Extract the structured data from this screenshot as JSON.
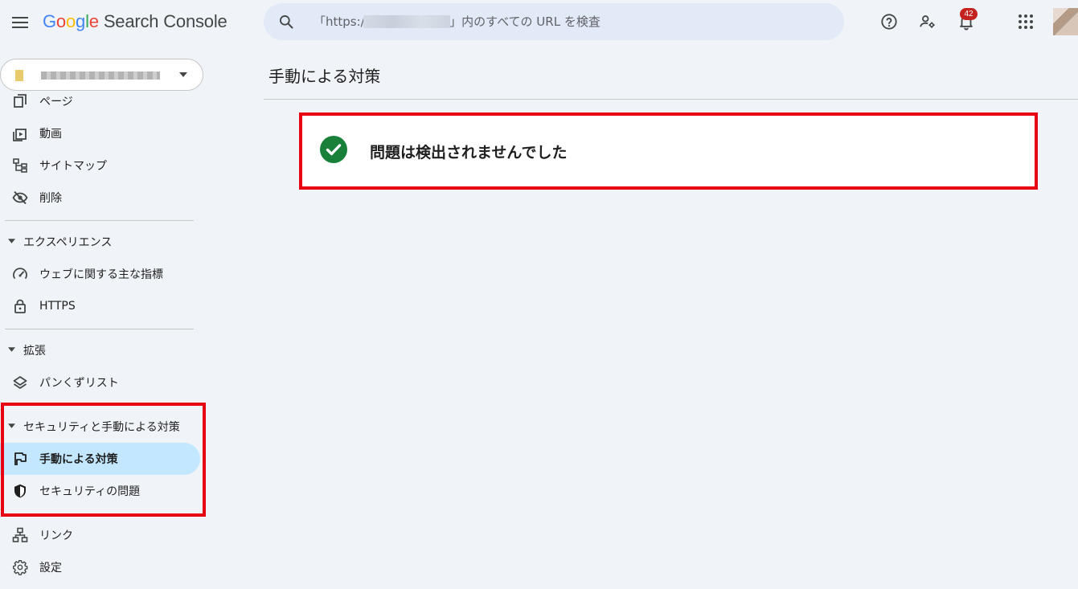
{
  "header": {
    "logo_letters": [
      {
        "ch": "G",
        "color": "#4285F4"
      },
      {
        "ch": "o",
        "color": "#EA4335"
      },
      {
        "ch": "o",
        "color": "#FBBC05"
      },
      {
        "ch": "g",
        "color": "#4285F4"
      },
      {
        "ch": "l",
        "color": "#34A853"
      },
      {
        "ch": "e",
        "color": "#EA4335"
      }
    ],
    "product_name": "Search Console",
    "search_placeholder": "「https://                    /」内のすべての URL を検査",
    "notification_count": "42",
    "icons": [
      "menu-icon",
      "search-icon",
      "help-icon",
      "manage-users-icon",
      "notifications-icon",
      "apps-icon"
    ]
  },
  "sidebar": {
    "items": [
      {
        "label": "ページ",
        "icon": "pages-icon"
      },
      {
        "label": "動画",
        "icon": "video-icon"
      },
      {
        "label": "サイトマップ",
        "icon": "sitemap-icon"
      },
      {
        "label": "削除",
        "icon": "removals-icon"
      }
    ],
    "sections": [
      {
        "title": "エクスペリエンス",
        "items": [
          {
            "label": "ウェブに関する主な指標",
            "icon": "speed-icon"
          },
          {
            "label": "HTTPS",
            "icon": "lock-icon"
          }
        ]
      },
      {
        "title": "拡張",
        "items": [
          {
            "label": "パンくずリスト",
            "icon": "layers-icon"
          }
        ]
      },
      {
        "title": "セキュリティと手動による対策",
        "items": [
          {
            "label": "手動による対策",
            "icon": "flag-icon",
            "active": true
          },
          {
            "label": "セキュリティの問題",
            "icon": "shield-icon"
          }
        ]
      }
    ],
    "bottom_items": [
      {
        "label": "リンク",
        "icon": "links-icon"
      },
      {
        "label": "設定",
        "icon": "settings-icon"
      }
    ]
  },
  "main": {
    "title": "手動による対策",
    "result_message": "問題は検出されませんでした"
  },
  "colors": {
    "background": "#f0f4f9",
    "search_bg": "#e3eaf7",
    "active_nav": "#c2e7ff",
    "success_green": "#188038",
    "highlight_red": "#e60012",
    "badge_red": "#c5221f"
  }
}
